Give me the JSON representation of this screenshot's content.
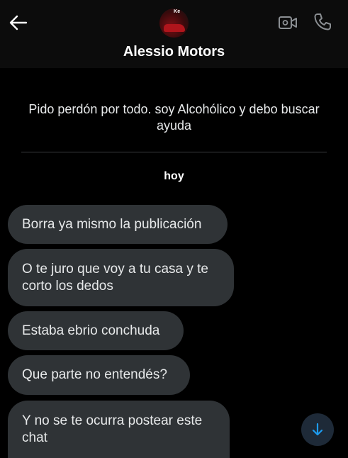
{
  "header": {
    "contact_name": "Alessio Motors",
    "avatar_logo_text": "Ke"
  },
  "conversation": {
    "previous_message": "Pido perdón por todo. soy Alcohólico y debo buscar ayuda",
    "date_separator": "hoy",
    "messages": [
      {
        "text": "Borra ya mismo la publicación"
      },
      {
        "text": "O te juro que voy a tu casa y te corto los dedos"
      },
      {
        "text": "Estaba ebrio conchuda"
      },
      {
        "text": "Que parte no entendés?"
      },
      {
        "text": "Y no se te ocurra postear este chat"
      }
    ]
  },
  "colors": {
    "background": "#000000",
    "header_background": "#0c0c0c",
    "bubble": "#2f3336",
    "text": "#e7e9ea",
    "accent": "#1d9bf0",
    "icon_gray": "#8b8f93"
  },
  "icons": {
    "back": "arrow-left-icon",
    "video": "video-camera-icon",
    "call": "phone-icon",
    "scroll": "arrow-down-icon"
  }
}
